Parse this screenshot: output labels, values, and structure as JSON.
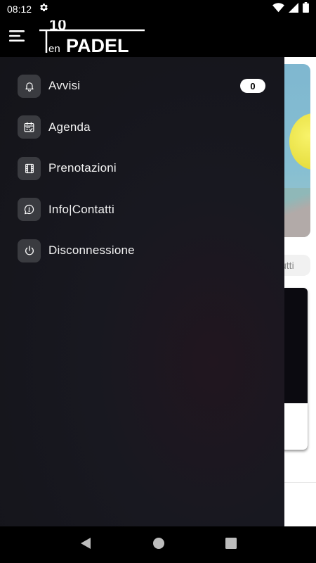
{
  "status_bar": {
    "time": "08:12",
    "icons": [
      "settings-gear-icon",
      "wifi-icon",
      "cellular-signal-icon",
      "battery-icon"
    ]
  },
  "app_bar": {
    "menu_icon": "hamburger-menu-icon",
    "logo_text_top": "10",
    "logo_text_en": "en",
    "logo_text_main": "PADEL"
  },
  "background": {
    "chip_text": "utti"
  },
  "drawer": {
    "items": [
      {
        "label": "Avvisi",
        "icon": "bell-icon",
        "badge": "0"
      },
      {
        "label": "Agenda",
        "icon": "calendar-icon"
      },
      {
        "label": "Prenotazioni",
        "icon": "film-icon"
      },
      {
        "label": "Info|Contatti",
        "icon": "chat-icon"
      },
      {
        "label": "Disconnessione",
        "icon": "power-icon"
      }
    ]
  },
  "nav_bar": {
    "buttons": [
      "back-icon",
      "home-icon",
      "recents-icon"
    ]
  },
  "colors": {
    "drawer_bg": "#141419",
    "icon_box": "#3a3b40",
    "badge_bg": "#ffffff"
  }
}
